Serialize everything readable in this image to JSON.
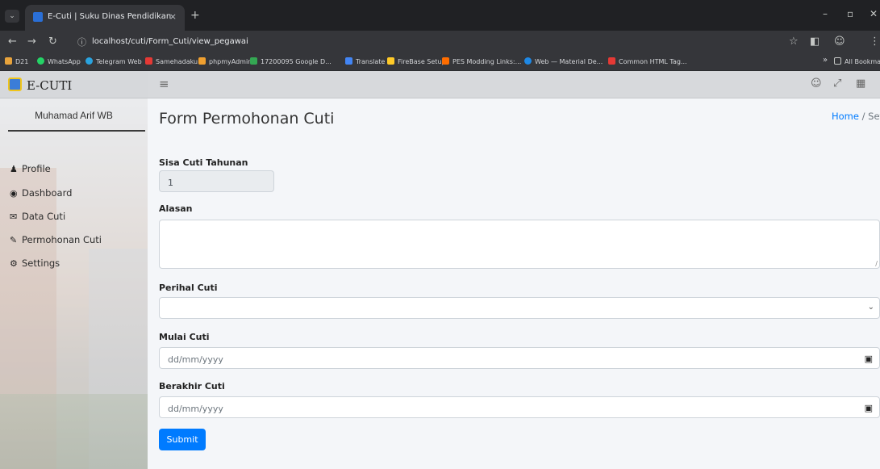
{
  "browser": {
    "tab_title": "E-Cuti | Suku Dinas Pendidikan",
    "tab_close": "×",
    "new_tab": "+",
    "url": "localhost/cuti/Form_Cuti/view_pegawai",
    "bookmarks": [
      {
        "label": "D21",
        "color": "#e8a33c"
      },
      {
        "label": "WhatsApp",
        "color": "#25d366"
      },
      {
        "label": "Telegram Web",
        "color": "#2aa3df"
      },
      {
        "label": "Samehadaku",
        "color": "#e53935"
      },
      {
        "label": "phpmyAdmin",
        "color": "#f0a030"
      },
      {
        "label": "17200095 Google D...",
        "color": "#34a853"
      },
      {
        "label": "Translate",
        "color": "#4285f4"
      },
      {
        "label": "FireBase Setup",
        "color": "#ffca28"
      },
      {
        "label": "PES Modding Links:...",
        "color": "#ff6d00"
      },
      {
        "label": "Web — Material De...",
        "color": "#1e88e5"
      },
      {
        "label": "Common HTML Tag...",
        "color": "#e53935"
      }
    ],
    "bookmarks_overflow": "»",
    "all_bookmarks": "All Bookmark"
  },
  "app": {
    "brand": "E-CUTI",
    "user_name": "Muhamad Arif WB",
    "menu": [
      {
        "label": "Profile",
        "icon": "user-icon",
        "glyph": "👤"
      },
      {
        "label": "Dashboard",
        "icon": "dashboard-icon",
        "glyph": "⚙"
      },
      {
        "label": "Data Cuti",
        "icon": "envelope-icon",
        "glyph": "✉"
      },
      {
        "label": "Permohonan Cuti",
        "icon": "edit-icon",
        "glyph": "✎"
      },
      {
        "label": "Settings",
        "icon": "gear-icon",
        "glyph": "⚙"
      }
    ]
  },
  "page": {
    "title": "Form Permohonan Cuti",
    "breadcrumb_home": "Home",
    "breadcrumb_sep": " / ",
    "breadcrumb_current": "Settings"
  },
  "form": {
    "sisa_label": "Sisa Cuti Tahunan",
    "sisa_value": "1",
    "alasan_label": "Alasan",
    "perihal_label": "Perihal Cuti",
    "mulai_label": "Mulai Cuti",
    "mulai_placeholder": "dd/mm/yyyy",
    "berakhir_label": "Berakhir Cuti",
    "berakhir_placeholder": "dd/mm/yyyy",
    "submit_label": "Submit"
  }
}
